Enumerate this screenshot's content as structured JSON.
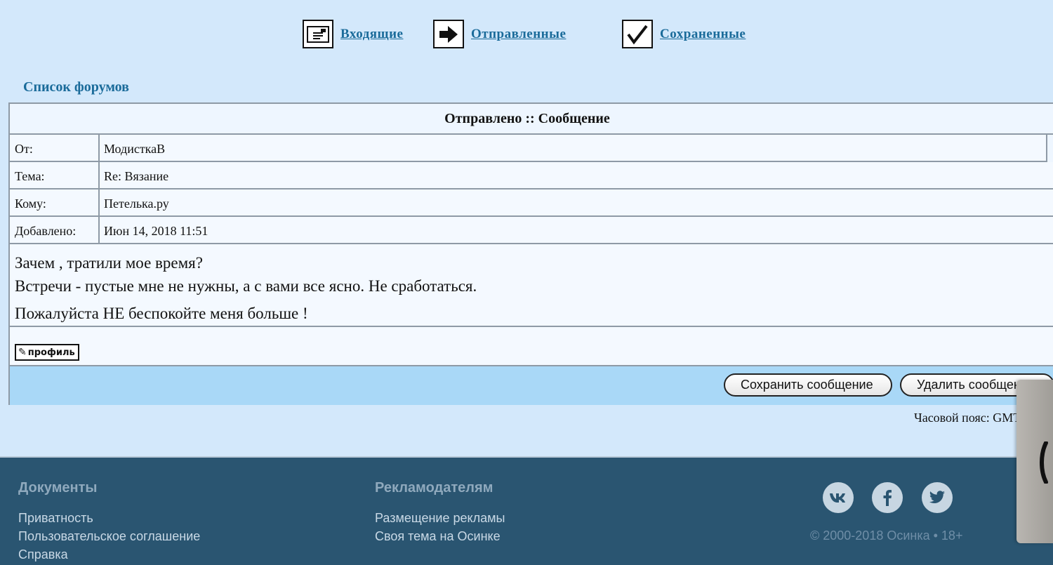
{
  "nav": {
    "inbox_label": "Входящие",
    "sent_label": "Отправленные",
    "saved_label": "Сохраненные"
  },
  "forum_list_link": "Список форумов",
  "message": {
    "header": "Отправлено :: Сообщение",
    "fields": [
      {
        "label": "От:",
        "value": "МодисткаВ"
      },
      {
        "label": "Тема:",
        "value": "Re: Вязание"
      },
      {
        "label": "Кому:",
        "value": "Петелька.ру"
      },
      {
        "label": "Добавлено:",
        "value": "Июн 14, 2018 11:51"
      }
    ],
    "body_lines": [
      "Зачем , тратили мое время?",
      "Встречи - пустые мне не нужны, а с вами все ясно. Не сработаться.",
      "Пожалуйста НЕ беспокойте меня больше !"
    ],
    "profile_button": "профиль",
    "save_button": "Сохранить сообщение",
    "delete_button": "Удалить сообщение"
  },
  "timezone_text": "Часовой пояс: GMT",
  "footer": {
    "documents": {
      "heading": "Документы",
      "links": [
        "Приватность",
        "Пользовательское соглашение",
        "Справка"
      ]
    },
    "advertisers": {
      "heading": "Рекламодателям",
      "links": [
        "Размещение рекламы",
        "Своя тема на Осинке"
      ]
    },
    "social": [
      {
        "icon": "vk-icon",
        "glyph": "vk"
      },
      {
        "icon": "facebook-icon",
        "glyph": "f"
      },
      {
        "icon": "twitter-icon",
        "glyph": "t"
      }
    ],
    "copyright": "© 2000-2018 Осинка • 18+"
  },
  "colors": {
    "page_bg": "#d3e8fb",
    "link": "#1a6b9a",
    "action_bar": "#a9d8f7",
    "footer_bg": "#2a5571"
  }
}
